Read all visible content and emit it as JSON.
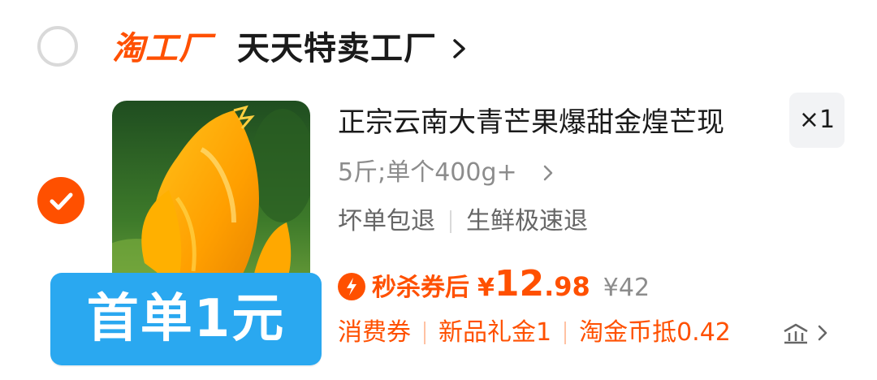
{
  "store": {
    "logo_text": "淘工厂",
    "name": "天天特卖工厂"
  },
  "item": {
    "badge": "首单1元",
    "title": "正宗云南大青芒果爆甜金煌芒现",
    "quantity": "×1",
    "sku": "5斤;单个400g+",
    "services": [
      "坏单包退",
      "生鲜极速退"
    ],
    "price": {
      "label": "秒杀券后",
      "currency": "¥",
      "integer": "12",
      "decimal": ".98",
      "original": "¥42"
    },
    "coupons": [
      "消费券",
      "新品礼金1",
      "淘金币抵0.42"
    ],
    "image": "mango-product-photo"
  },
  "colors": {
    "accent": "#ff5000",
    "badge": "#2aa8f0",
    "muted": "#8c8c8c"
  },
  "icons": {
    "store_radio": "radio-unchecked-icon",
    "item_check": "check-icon",
    "flash": "lightning-icon",
    "coupon_detail": "coupon-detail-icon"
  }
}
